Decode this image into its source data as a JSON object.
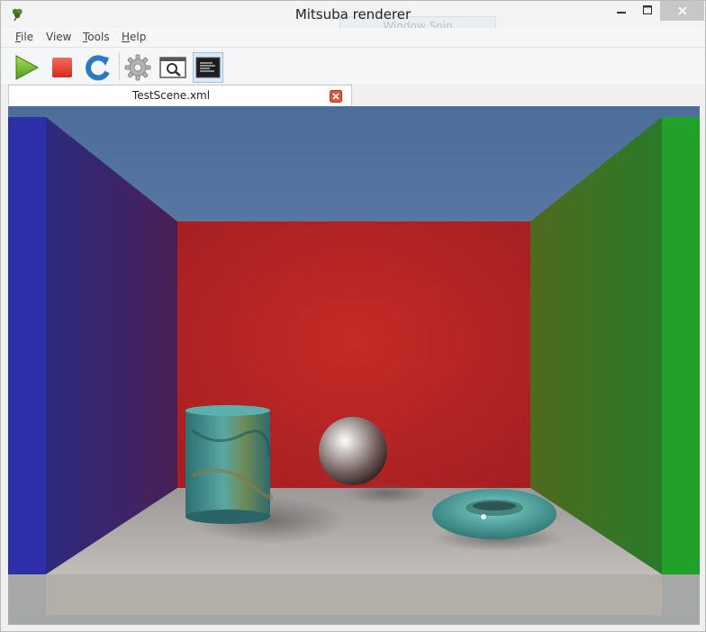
{
  "window": {
    "title": "Mitsuba renderer",
    "app_icon": "clover-icon",
    "overlay_text": "Window Snip",
    "controls": {
      "minimize": "minimize-icon",
      "maximize": "maximize-icon",
      "close": "close-icon"
    }
  },
  "menu": {
    "items": [
      {
        "key": "F",
        "rest": "ile"
      },
      {
        "key": "",
        "rest": "View"
      },
      {
        "key": "T",
        "rest": "ools"
      },
      {
        "key": "H",
        "rest": "elp"
      }
    ]
  },
  "toolbar": {
    "buttons": [
      {
        "icon": "play-icon",
        "color": "#6cbf2a"
      },
      {
        "icon": "stop-icon",
        "color": "#e03b2e"
      },
      {
        "icon": "refresh-icon",
        "color": "#2b78c9"
      },
      {
        "icon": "gear-icon",
        "color": "#9a9a9a"
      },
      {
        "icon": "preview-magnifier-icon",
        "color": "#444444"
      },
      {
        "icon": "console-icon",
        "color": "#1d1d1d",
        "active": true
      }
    ]
  },
  "tabs": [
    {
      "label": "TestScene.xml",
      "close_icon": "close-icon",
      "close_color": "#e0553a"
    }
  ],
  "render": {
    "left_wall_color": "#2c2fa8",
    "right_wall_color": "#22a12a",
    "back_wall_color": "#c02424",
    "floor_color": "#b5b0ab",
    "sky_color": "#6a8ab0"
  }
}
